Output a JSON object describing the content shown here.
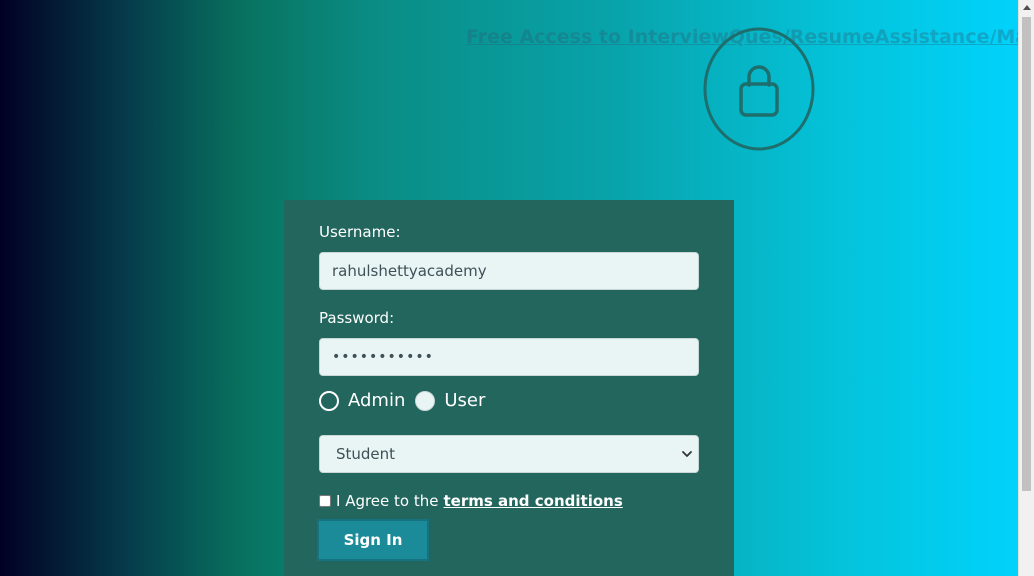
{
  "header": {
    "top_link": "Free Access to InterviewQues/ResumeAssistance/Material"
  },
  "icons": {
    "lock": "lock-icon",
    "chevron": "chevron-down-icon",
    "scroll_up": "scroll-up-arrow-icon"
  },
  "login_form": {
    "username_label": "Username:",
    "username_value": "rahulshettyacademy",
    "password_label": "Password:",
    "password_value": "•••••••••••",
    "radio_admin_label": "Admin",
    "radio_user_label": "User",
    "role_select_value": "Student",
    "terms_prefix": "I Agree to the",
    "terms_link": "terms and conditions",
    "signin_label": "Sign In"
  },
  "colors": {
    "panel": "#22665d",
    "button": "#1b8a99",
    "gradient_start": "#020024",
    "gradient_end": "#00d4ff"
  }
}
